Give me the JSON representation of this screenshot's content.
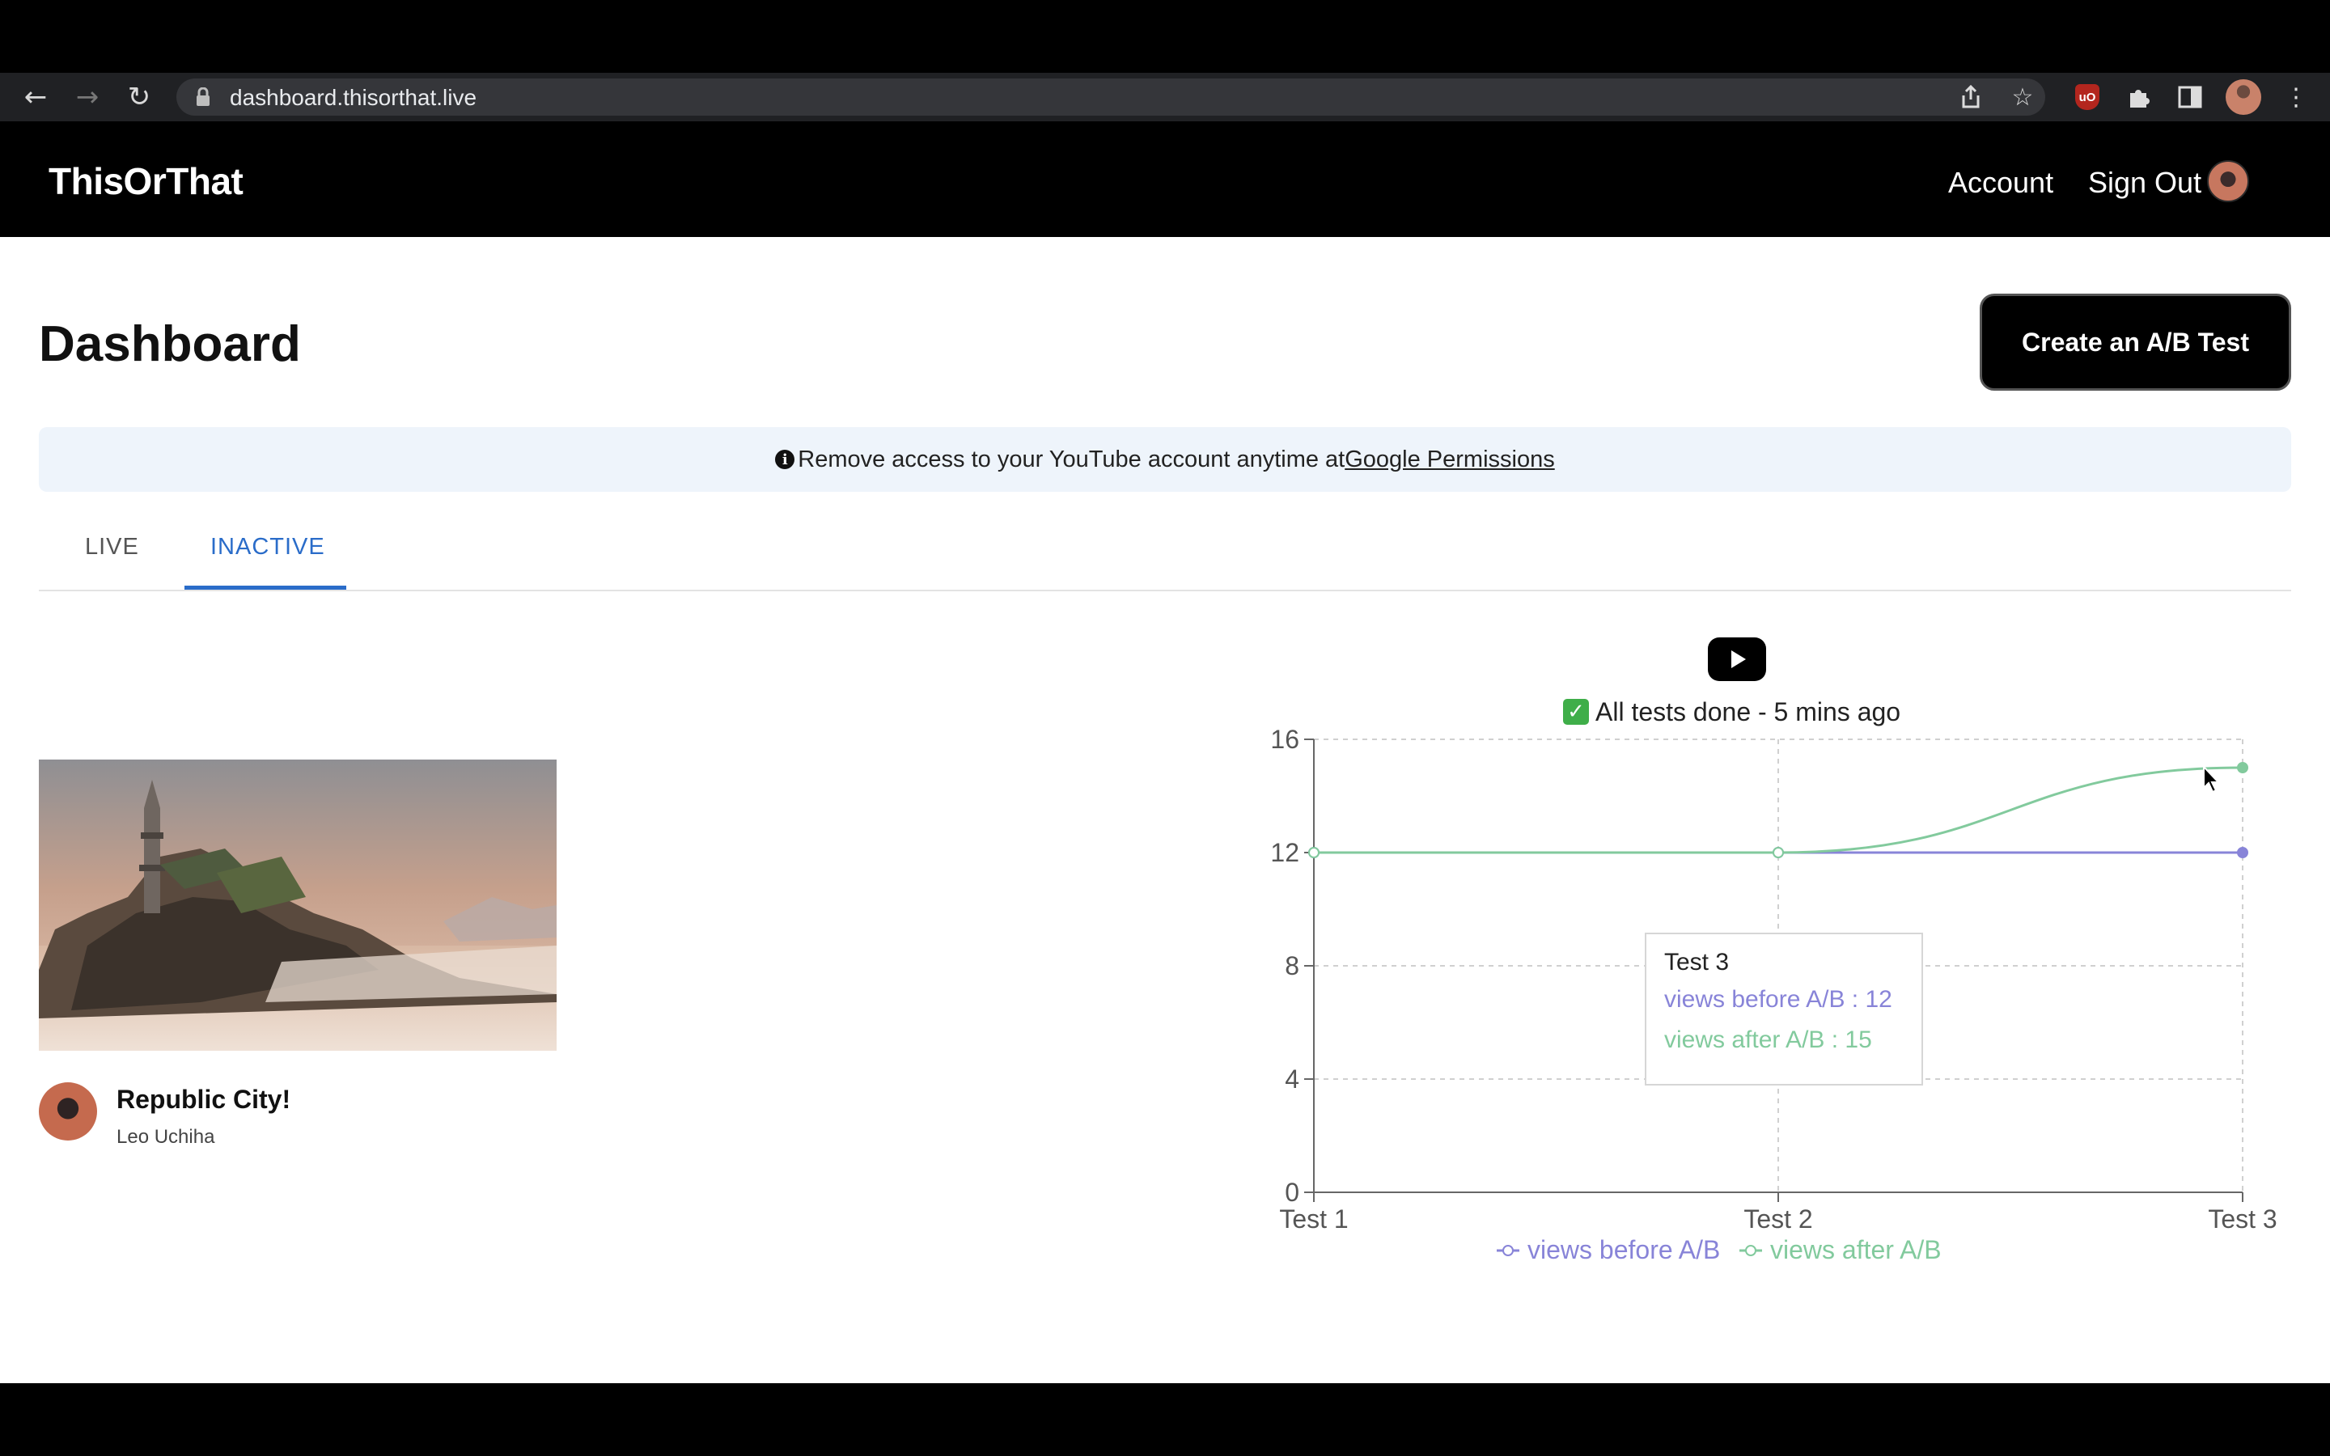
{
  "browser": {
    "url": "dashboard.thisorthat.live",
    "icons": [
      "back-arrow-icon",
      "forward-arrow-icon",
      "reload-icon",
      "lock-icon",
      "share-icon",
      "star-icon",
      "ublock-icon",
      "puzzle-icon",
      "side-panel-icon",
      "profile-avatar",
      "menu-dots-icon"
    ],
    "ext_badge": "uO"
  },
  "header": {
    "brand": "ThisOrThat",
    "account": "Account",
    "sign_out": "Sign Out"
  },
  "main": {
    "title": "Dashboard",
    "create_button": "Create an A/B Test",
    "banner_text": "Remove access to your YouTube account anytime at",
    "banner_link": "Google Permissions",
    "tabs": [
      {
        "label": "LIVE",
        "active": false
      },
      {
        "label": "INACTIVE",
        "active": true
      }
    ]
  },
  "card": {
    "title": "Republic City!",
    "author": "Leo Uchiha"
  },
  "status": {
    "text": "All tests done - 5 mins ago"
  },
  "tooltip": {
    "title": "Test 3",
    "before": "views before A/B : 12",
    "after": "views after A/B : 15"
  },
  "colors": {
    "accent_tab": "#2a6cc9",
    "before_series": "#8884d8",
    "after_series": "#82ca9d"
  },
  "chart_data": {
    "type": "line",
    "categories": [
      "Test 1",
      "Test 2",
      "Test 3"
    ],
    "series": [
      {
        "name": "views before A/B",
        "values": [
          12,
          12,
          12
        ],
        "color": "#8884d8"
      },
      {
        "name": "views after A/B",
        "values": [
          12,
          12,
          15
        ],
        "color": "#82ca9d"
      }
    ],
    "yticks": [
      "0",
      "4",
      "8",
      "12",
      "16"
    ],
    "ylim": [
      0,
      16
    ],
    "grid": true,
    "legend": "bottom-center"
  }
}
